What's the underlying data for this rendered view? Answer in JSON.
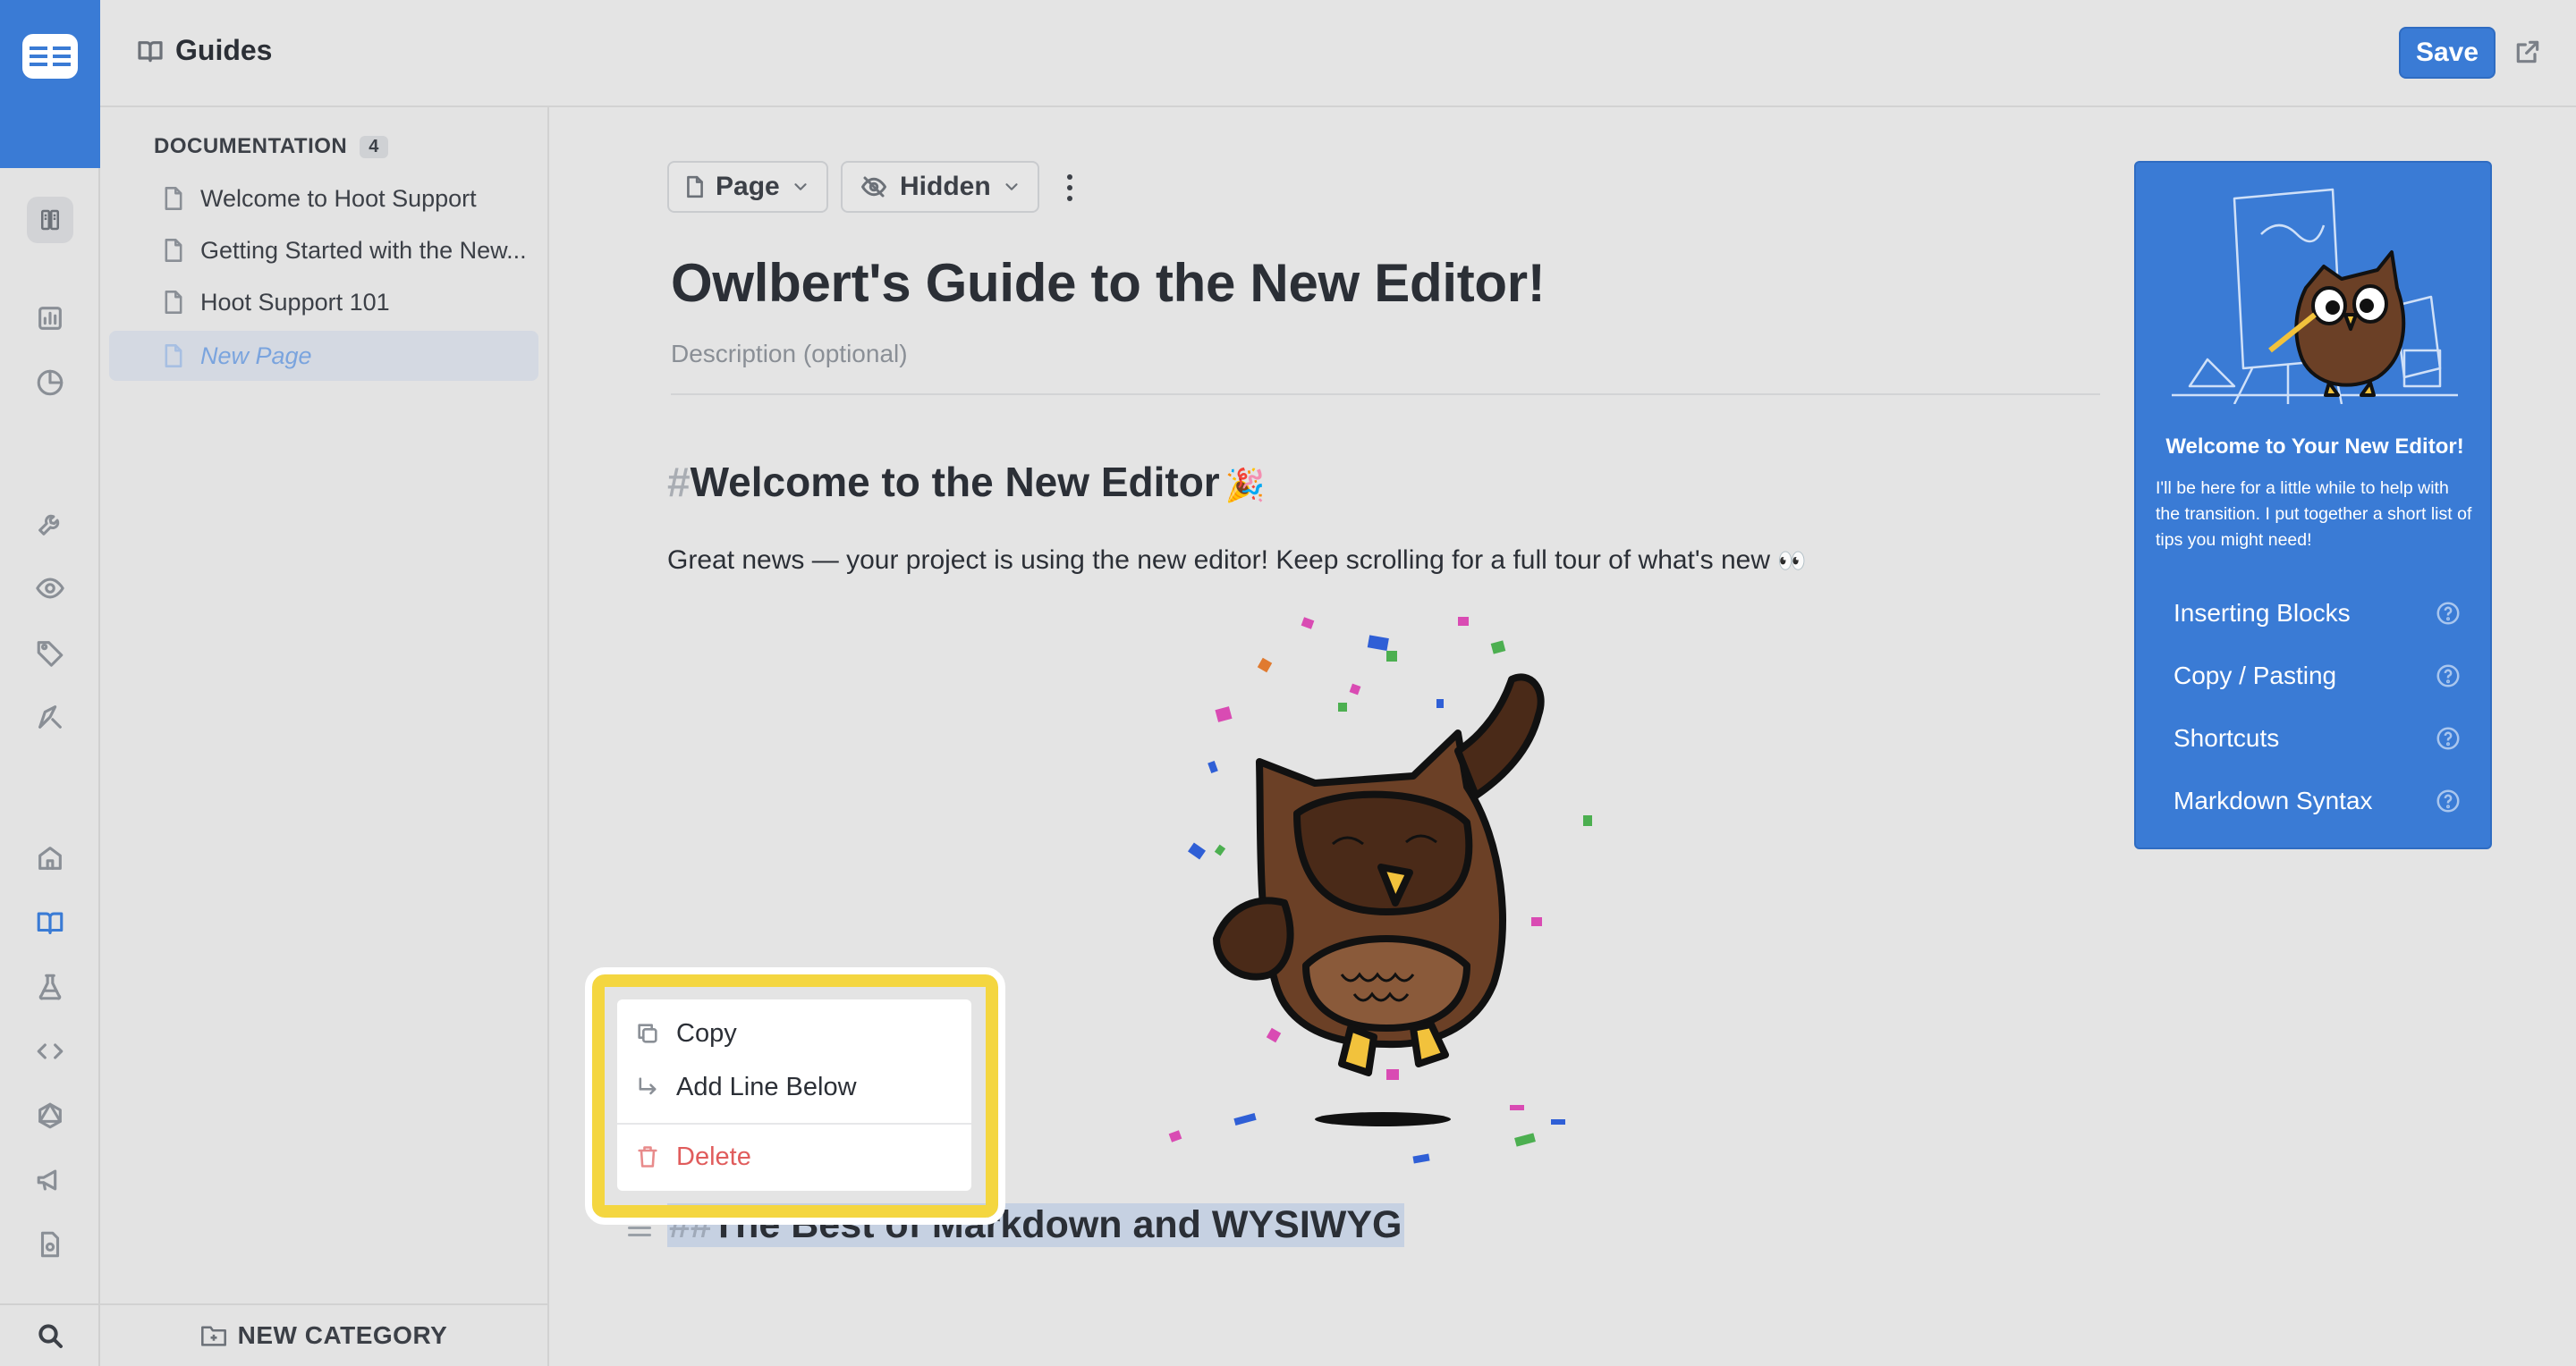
{
  "app": {
    "title": "Guides"
  },
  "header": {
    "save_label": "Save"
  },
  "sidebar": {
    "category": "DOCUMENTATION",
    "count": "4",
    "items": [
      {
        "label": "Welcome to Hoot Support",
        "active": false
      },
      {
        "label": "Getting Started with the New...",
        "active": false
      },
      {
        "label": "Hoot Support 101",
        "active": false
      },
      {
        "label": "New Page",
        "active": true
      }
    ],
    "new_category": "NEW CATEGORY"
  },
  "toolbar": {
    "type_label": "Page",
    "visibility_label": "Hidden"
  },
  "page": {
    "title": "Owlbert's Guide to the New Editor!",
    "description_placeholder": "Description (optional)",
    "h1_hash": "#",
    "h1_text": "Welcome to the New Editor",
    "h1_emoji": "🎉",
    "paragraph": "Great news — your project is using the new editor! Keep scrolling for a full tour of what's new",
    "paragraph_emoji": "👀",
    "h2_hash": "##",
    "h2_text": "The Best of Markdown and WYSIWYG"
  },
  "context_menu": {
    "copy": "Copy",
    "add_line_below": "Add Line Below",
    "delete": "Delete"
  },
  "welcome_card": {
    "title": "Welcome to Your New Editor!",
    "text": "I'll be here for a little while to help with the transition. I put together a short list of tips you might need!",
    "links": [
      "Inserting Blocks",
      "Copy / Pasting",
      "Shortcuts",
      "Markdown Syntax"
    ]
  },
  "colors": {
    "accent": "#3a7bd5",
    "highlight": "#f4d640",
    "danger": "#e05c5c"
  }
}
